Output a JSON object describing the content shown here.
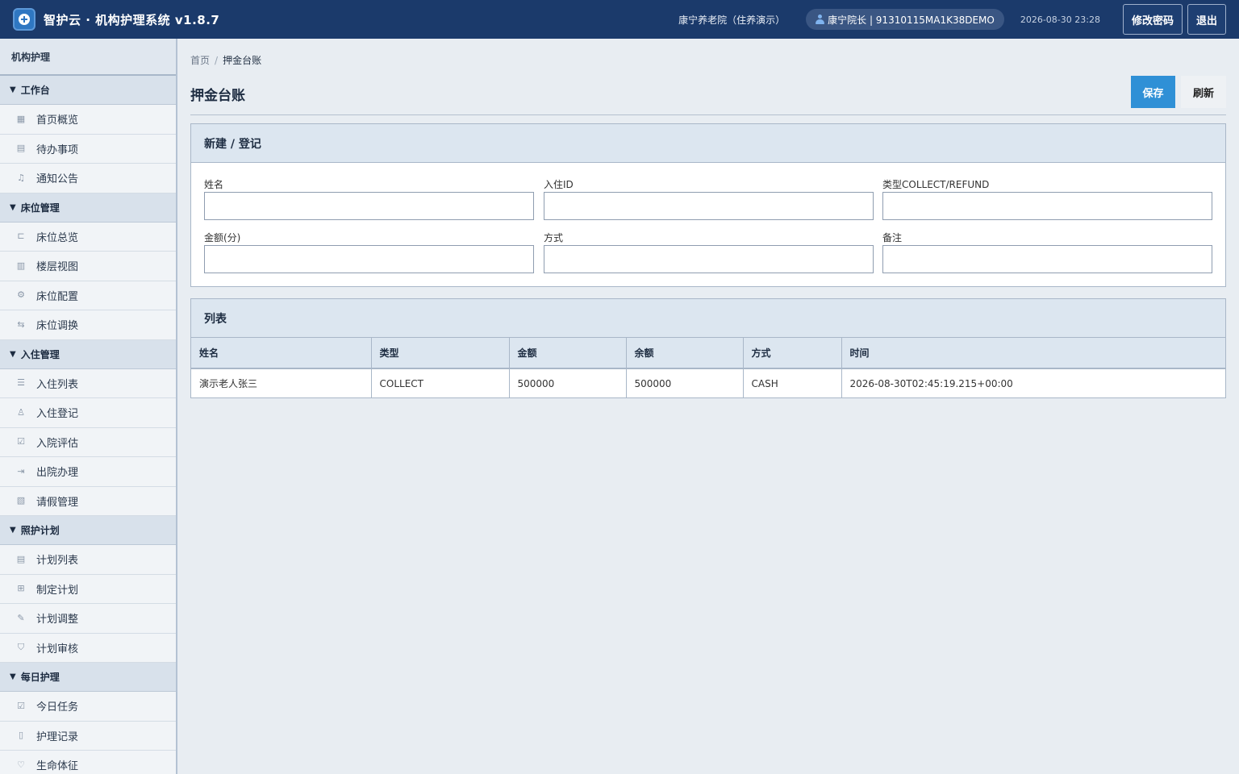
{
  "header": {
    "title": "智护云 · 机构护理系统 v1.8.7",
    "org": "康宁养老院（住养演示）",
    "user": "康宁院长 | 91310115MA1K38DEMO",
    "datetime": "2026-08-30 23:28",
    "change_password": "修改密码",
    "logout": "退出"
  },
  "sidebar": {
    "title": "机构护理",
    "groups": [
      {
        "label": "工作台",
        "items": [
          {
            "label": "首页概览",
            "icon": "grid-icon"
          },
          {
            "label": "待办事项",
            "icon": "clipboard-icon"
          },
          {
            "label": "通知公告",
            "icon": "bell-icon"
          }
        ]
      },
      {
        "label": "床位管理",
        "items": [
          {
            "label": "床位总览",
            "icon": "bed-icon"
          },
          {
            "label": "楼层视图",
            "icon": "building-icon"
          },
          {
            "label": "床位配置",
            "icon": "gear-icon"
          },
          {
            "label": "床位调换",
            "icon": "swap-icon"
          }
        ]
      },
      {
        "label": "入住管理",
        "items": [
          {
            "label": "入住列表",
            "icon": "list-icon"
          },
          {
            "label": "入住登记",
            "icon": "user-add-icon"
          },
          {
            "label": "入院评估",
            "icon": "clipboard-check-icon"
          },
          {
            "label": "出院办理",
            "icon": "exit-icon"
          },
          {
            "label": "请假管理",
            "icon": "calendar-off-icon"
          }
        ]
      },
      {
        "label": "照护计划",
        "items": [
          {
            "label": "计划列表",
            "icon": "clipboard-icon"
          },
          {
            "label": "制定计划",
            "icon": "file-plus-icon"
          },
          {
            "label": "计划调整",
            "icon": "pencil-icon"
          },
          {
            "label": "计划审核",
            "icon": "shield-icon"
          }
        ]
      },
      {
        "label": "每日护理",
        "items": [
          {
            "label": "今日任务",
            "icon": "checkbox-icon"
          },
          {
            "label": "护理记录",
            "icon": "notebook-icon"
          },
          {
            "label": "生命体征",
            "icon": "heart-pulse-icon"
          }
        ]
      }
    ]
  },
  "breadcrumb": {
    "home": "首页",
    "separator": "/",
    "current": "押金台账"
  },
  "page": {
    "title": "押金台账",
    "save": "保存",
    "refresh": "刷新"
  },
  "form": {
    "title": "新建 / 登记",
    "fields": [
      {
        "label": "姓名",
        "value": ""
      },
      {
        "label": "入住ID",
        "value": ""
      },
      {
        "label": "类型COLLECT/REFUND",
        "value": ""
      },
      {
        "label": "金额(分)",
        "value": ""
      },
      {
        "label": "方式",
        "value": ""
      },
      {
        "label": "备注",
        "value": ""
      }
    ]
  },
  "list": {
    "title": "列表",
    "columns": [
      "姓名",
      "类型",
      "金额",
      "余额",
      "方式",
      "时间"
    ],
    "rows": [
      [
        "演示老人张三",
        "COLLECT",
        "500000",
        "500000",
        "CASH",
        "2026-08-30T02:45:19.215+00:00"
      ]
    ]
  }
}
